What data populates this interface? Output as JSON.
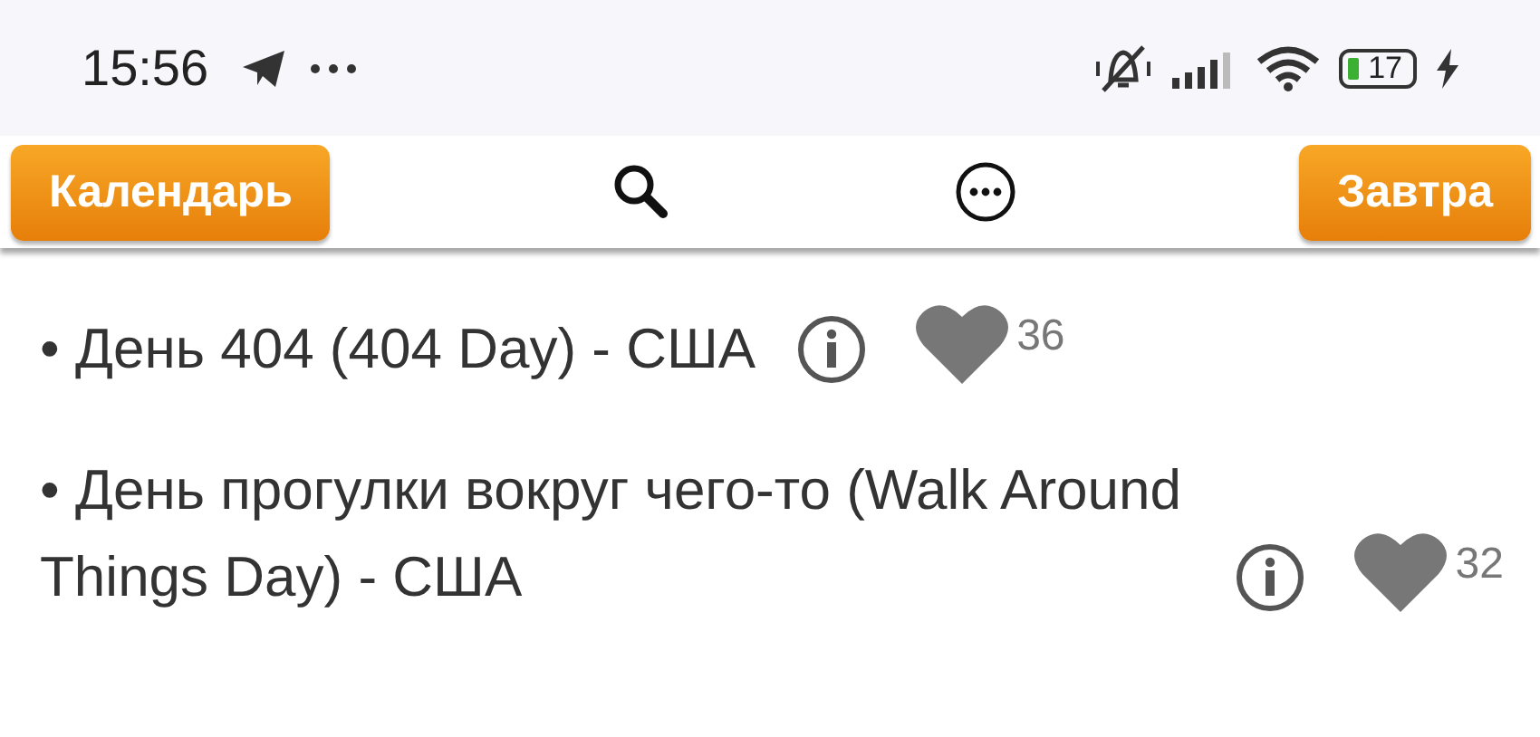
{
  "status_bar": {
    "time": "15:56",
    "battery": "17"
  },
  "toolbar": {
    "left_button": "Календарь",
    "right_button": "Завтра"
  },
  "items": [
    {
      "text": "• День 404 (404 Day) - США",
      "likes": "36"
    },
    {
      "text": "• День прогулки вокруг чего-то (Walk Around Things Day) - США",
      "likes": "32"
    }
  ]
}
